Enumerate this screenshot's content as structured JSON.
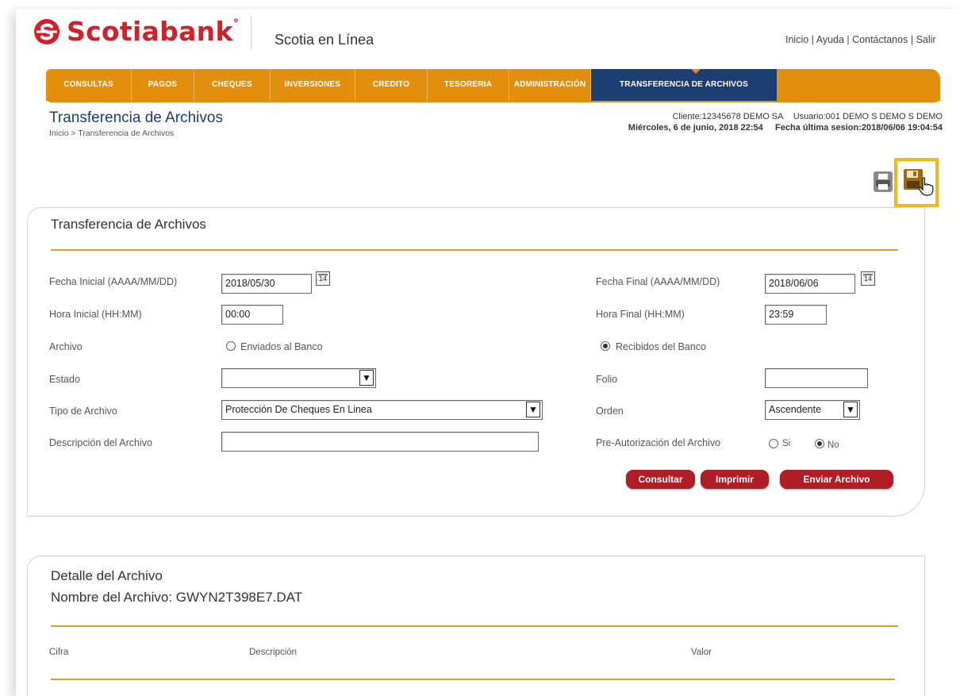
{
  "brand": {
    "name": "Scotiabank",
    "tm": "°",
    "product": "Scotia en Línea",
    "color": "#d1222a"
  },
  "toplinks": {
    "inicio": "Inicio",
    "ayuda": "Ayuda",
    "contacto": "Contáctanos",
    "salir": "Salir",
    "sep": "|"
  },
  "nav": {
    "items": [
      "CONSULTAS",
      "PAGOS",
      "CHEQUES",
      "INVERSIONES",
      "CREDITO",
      "TESORERIA",
      "ADMINISTRACIÓN",
      "TRANSFERENCIA DE ARCHIVOS"
    ],
    "active_index": 7,
    "color": "#e38f0e",
    "active_color": "#1c3e73"
  },
  "page": {
    "title": "Transferencia de Archivos",
    "breadcrumb": "Inicio > Transferencia de Archivos",
    "client": "Cliente:12345678 DEMO SA",
    "user": "Usuario:001 DEMO S DEMO S DEMO",
    "date": "Miércoles, 6 de junio, 2018 22:54",
    "last_session": "Fecha última sesion:2018/06/06 19:04:54"
  },
  "icons": {
    "print": "printer-icon",
    "save": "save-disk-icon",
    "cursor": "hand-cursor-icon"
  },
  "form": {
    "title": "Transferencia de Archivos",
    "fecha_inicial_label": "Fecha Inicial  (AAAA/MM/DD)",
    "fecha_inicial_value": "2018/05/30",
    "fecha_final_label": "Fecha Final  (AAAA/MM/DD)",
    "fecha_final_value": "2018/06/06",
    "calendar_label": "14",
    "hora_inicial_label": "Hora Inicial  (HH:MM)",
    "hora_inicial_value": "00:00",
    "hora_final_label": "Hora Final  (HH:MM)",
    "hora_final_value": "23:59",
    "archivo_label": "Archivo",
    "archivo_option_1": "Enviados al Banco",
    "archivo_option_2": "Recibidos del Banco",
    "archivo_selected": "Recibidos del Banco",
    "estado_label": "Estado",
    "estado_value": "",
    "folio_label": "Folio",
    "folio_value": "",
    "tipo_label": "Tipo de Archivo",
    "tipo_value": "Protección De Cheques En Linea",
    "orden_label": "Orden",
    "orden_value": "Ascendente",
    "descripcion_label": "Descripción del Archivo",
    "descripcion_value": "",
    "preaut_label": "Pre-Autorización del Archivo",
    "preaut_si": "Si",
    "preaut_no": "No",
    "preaut_selected": "No",
    "btn_consultar": "Consultar",
    "btn_imprimir": "Imprimir",
    "btn_enviar": "Enviar Archivo"
  },
  "detail": {
    "title": "Detalle del Archivo",
    "file_label": "Nombre del Archivo: GWYN2T398E7.DAT",
    "columns": [
      "Cifra",
      "Descripción",
      "Valor"
    ]
  }
}
